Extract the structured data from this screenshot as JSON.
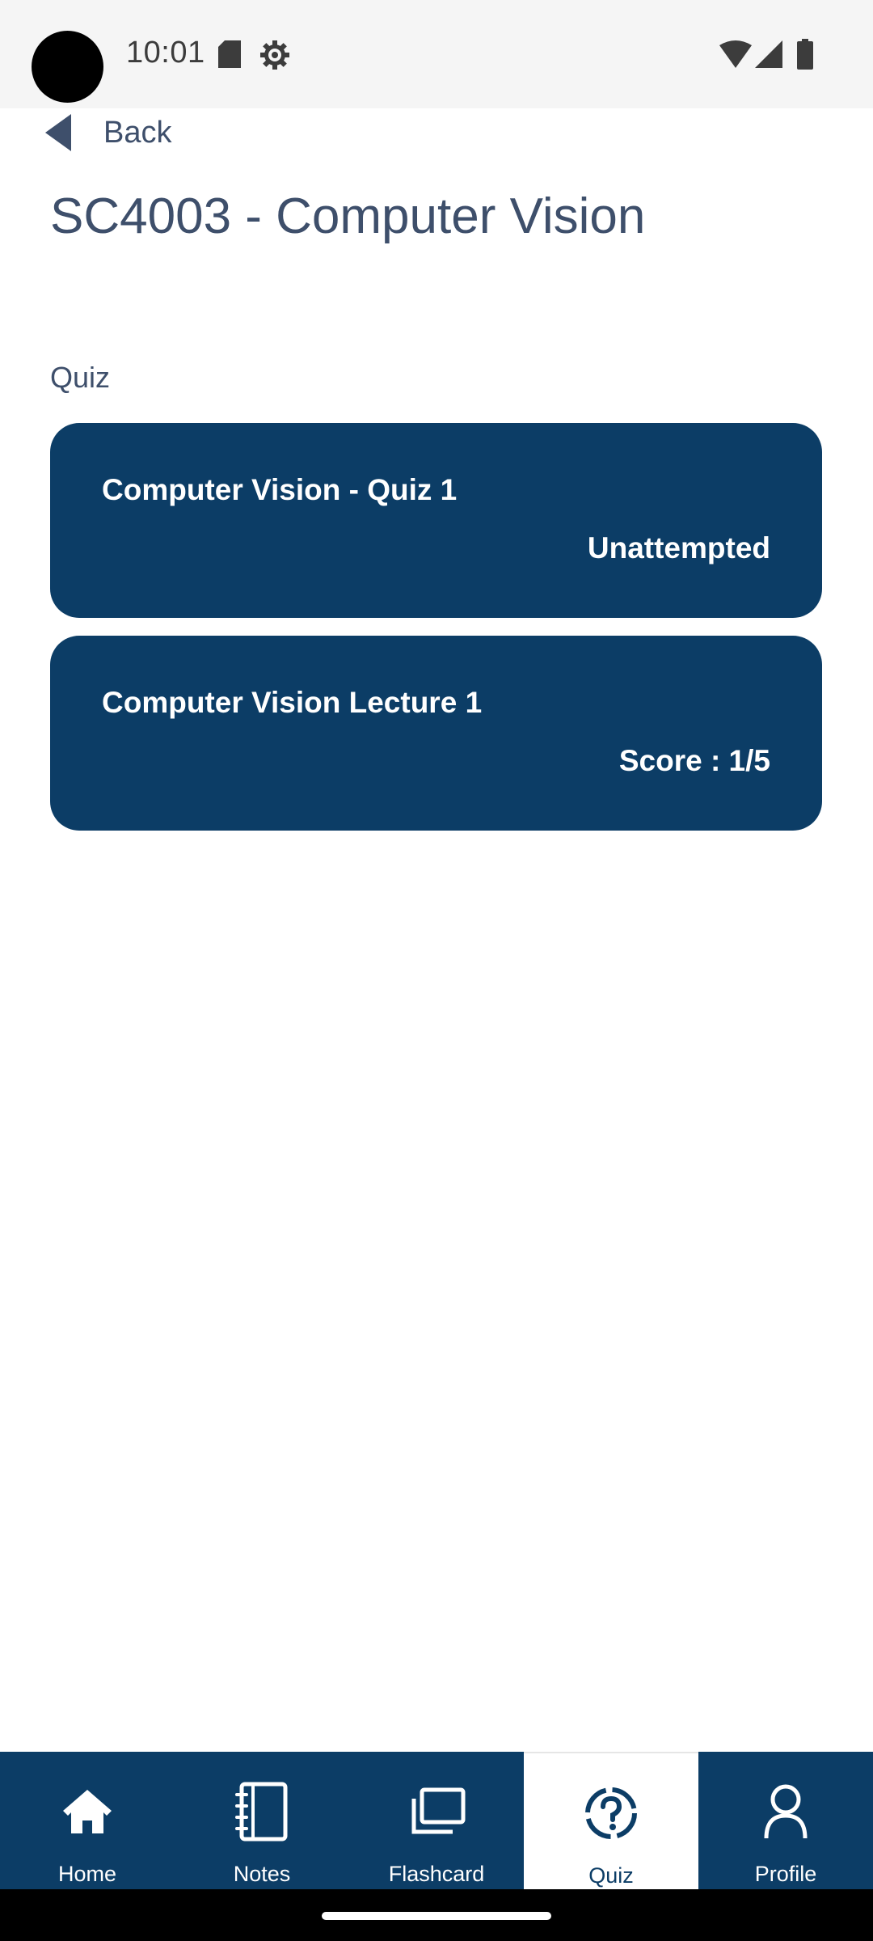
{
  "status_bar": {
    "time": "10:01",
    "icons": [
      "sd-card-icon",
      "settings-gear-icon",
      "wifi-icon",
      "cell-signal-icon",
      "battery-icon"
    ]
  },
  "header": {
    "back_label": "Back",
    "title": "SC4003 - Computer Vision"
  },
  "section": {
    "label": "Quiz"
  },
  "quizzes": [
    {
      "title": "Computer Vision - Quiz 1",
      "status": "Unattempted"
    },
    {
      "title": "Computer Vision Lecture 1",
      "status": "Score : 1/5"
    }
  ],
  "bottom_nav": {
    "items": [
      {
        "label": "Home",
        "icon": "home-icon",
        "active": false
      },
      {
        "label": "Notes",
        "icon": "notebook-icon",
        "active": false
      },
      {
        "label": "Flashcard",
        "icon": "flashcard-stack-icon",
        "active": false
      },
      {
        "label": "Quiz",
        "icon": "question-circle-icon",
        "active": true
      },
      {
        "label": "Profile",
        "icon": "person-icon",
        "active": false
      }
    ]
  },
  "colors": {
    "primary": "#0c3d66",
    "text": "#3e4f6b",
    "status_bar_bg": "#f5f5f5"
  }
}
